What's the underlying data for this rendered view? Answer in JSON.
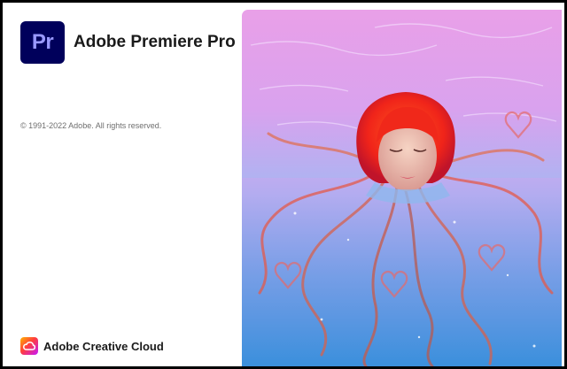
{
  "app": {
    "logo_text": "Pr",
    "title": "Adobe Premiere Pro",
    "logo_bg_color": "#00005b",
    "logo_fg_color": "#9999ff"
  },
  "copyright": "© 1991-2022 Adobe. All rights reserved.",
  "footer": {
    "brand": "Adobe Creative Cloud",
    "icon": "creative-cloud-icon"
  },
  "splash_art": {
    "subject": "woman-with-red-hair-in-water-artwork"
  }
}
